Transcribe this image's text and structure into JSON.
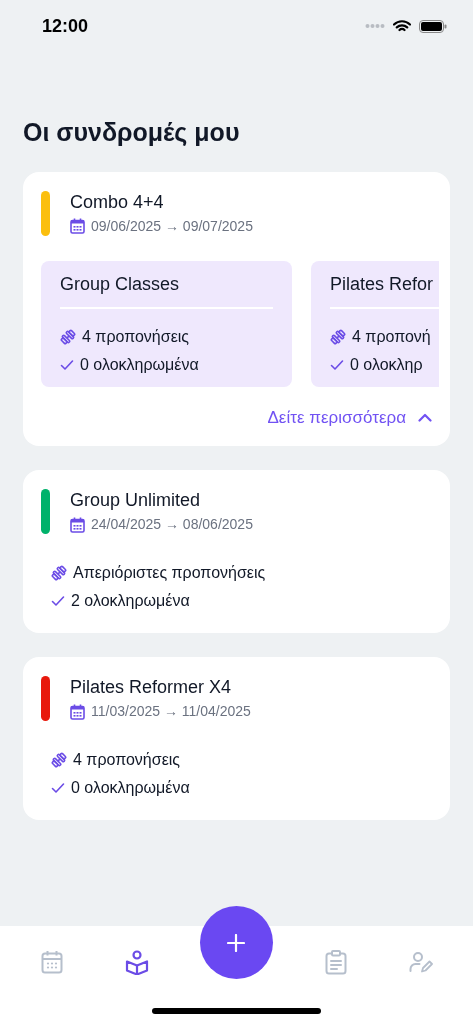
{
  "status_bar": {
    "time": "12:00"
  },
  "title": "Οι συνδρομές μου",
  "subscriptions": [
    {
      "name": "Combo 4+4",
      "color": "#fbbf0f",
      "dates": "09/06/2025 → 09/07/2025",
      "packages": [
        {
          "name": "Group Classes",
          "sessions": "4 προπονήσεις",
          "completed": "0 ολοκληρωμένα"
        },
        {
          "name": "Pilates Refor",
          "sessions": "4 προπονή",
          "completed": "0 ολοκληρ"
        }
      ],
      "more_link": {
        "label": "Δείτε περισσότερα",
        "expanded": true
      }
    },
    {
      "name": "Group Unlimited",
      "color": "#00b26b",
      "dates": "24/04/2025 → 08/06/2025",
      "sessions": "Απεριόριστες προπονήσεις",
      "completed": "2 ολοκληρωμένα"
    },
    {
      "name": "Pilates Reformer X4",
      "color": "#e8190c",
      "dates": "11/03/2025 → 11/04/2025",
      "sessions": "4 προπονήσεις",
      "completed": "0 ολοκληρωμένα"
    }
  ],
  "tab_bar": [
    {
      "kind": "calendar",
      "selected": false
    },
    {
      "kind": "book",
      "selected": true
    },
    {
      "kind": "add",
      "selected": false
    },
    {
      "kind": "clipboard",
      "selected": false
    },
    {
      "kind": "user-edit",
      "selected": false
    }
  ]
}
